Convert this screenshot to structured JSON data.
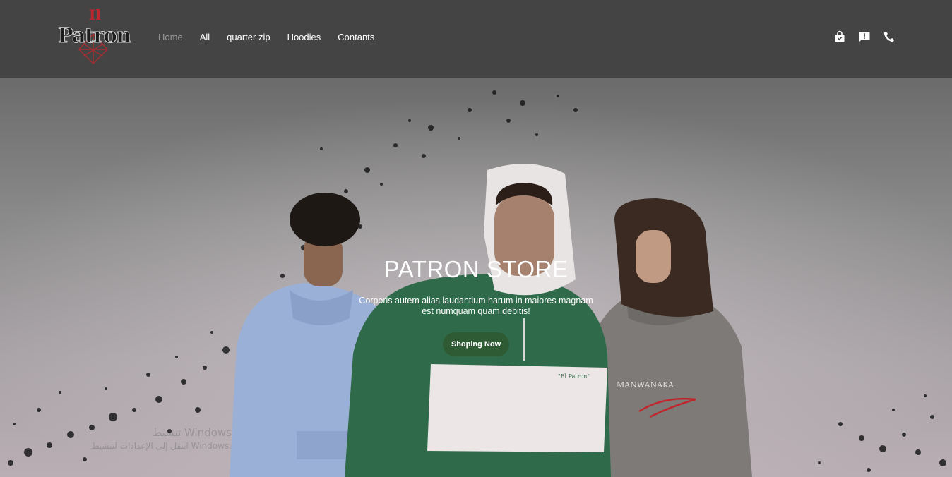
{
  "brand": {
    "name": "Patron",
    "accent_color": "#c0272d"
  },
  "nav": {
    "links": [
      {
        "label": "Home",
        "active": true
      },
      {
        "label": "All",
        "active": false
      },
      {
        "label": "quarter zip",
        "active": false
      },
      {
        "label": "Hoodies",
        "active": false
      },
      {
        "label": "Contants",
        "active": false
      }
    ],
    "icons": [
      "shopping-bag-icon",
      "feedback-icon",
      "phone-icon"
    ]
  },
  "hero": {
    "title": "PATRON STORE",
    "text": "Corporis autem alias laudantium harum in maiores magnam est numquam quam debitis!",
    "cta_label": "Shoping Now",
    "cta_color": "#2e5a34",
    "background_image": "three-models-in-hoodies-with-ink-splatter"
  },
  "watermark": {
    "line1": "تنشيط Windows",
    "line2": "انتقل إلى الإعدادات لتنشيط Windows."
  }
}
